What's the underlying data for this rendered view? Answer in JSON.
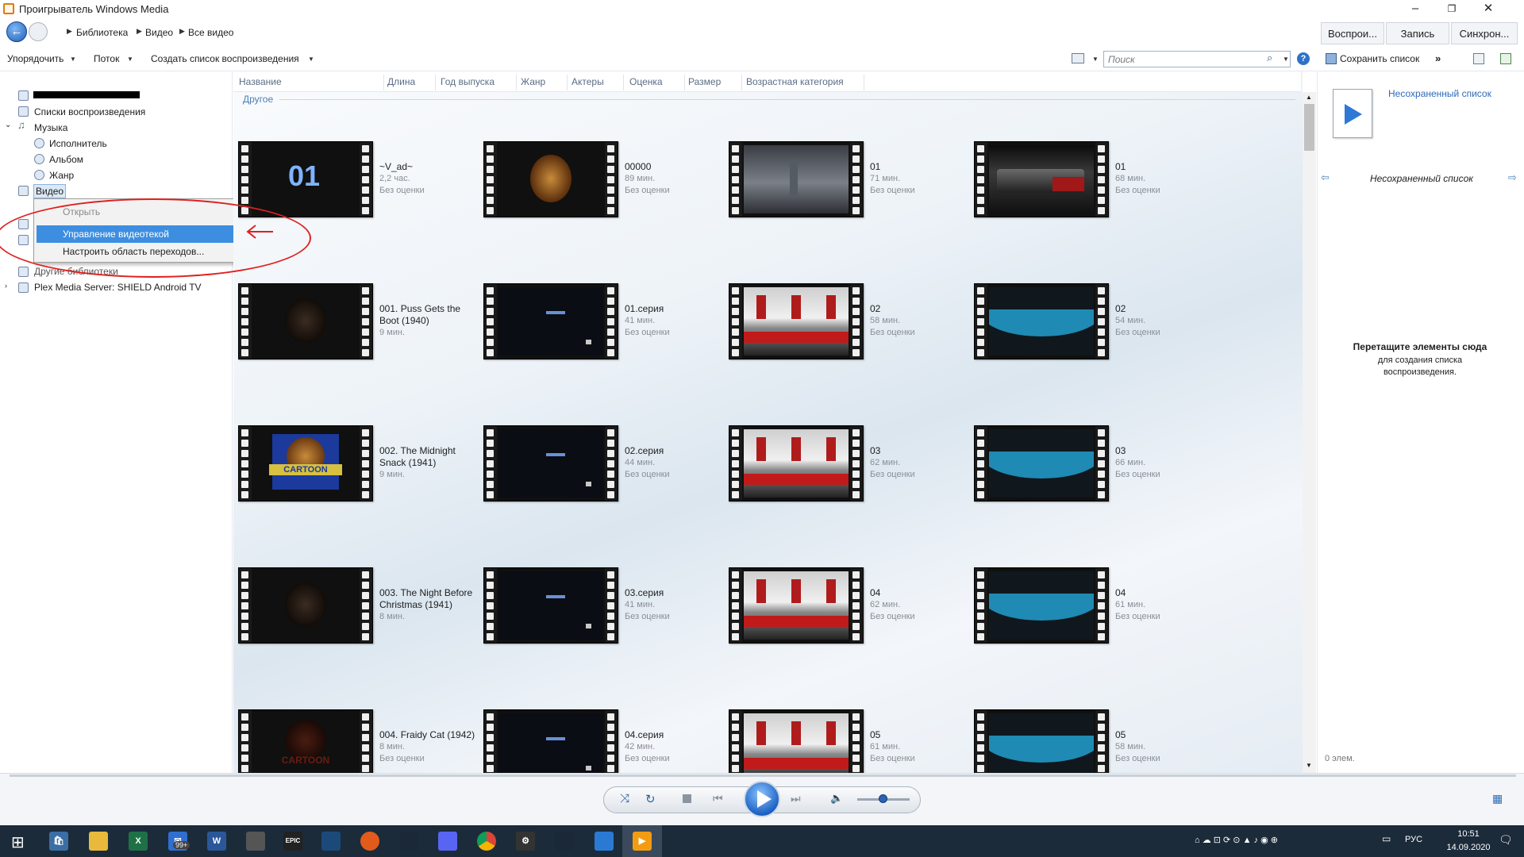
{
  "window": {
    "title": "Проигрыватель Windows Media"
  },
  "breadcrumb": [
    "Библиотека",
    "Видео",
    "Все видео"
  ],
  "tabs": [
    "Воспрои...",
    "Запись",
    "Синхрон..."
  ],
  "toolbar": {
    "organize": "Упорядочить",
    "stream": "Поток",
    "create_playlist": "Создать список воспроизведения",
    "search_placeholder": "Поиск",
    "save_list": "Сохранить список"
  },
  "nav": {
    "playlists": "Списки воспроизведения",
    "music": "Музыка",
    "artist": "Исполнитель",
    "album": "Альбом",
    "genre": "Жанр",
    "video": "Видео",
    "other_libraries": "Другие библиотеки",
    "plex": "Plex Media Server: SHIELD Android TV"
  },
  "context_menu": [
    "Открыть",
    "Управление видеотекой",
    "Настроить область переходов..."
  ],
  "columns": [
    "Название",
    "Длина",
    "Год выпуска",
    "Жанр",
    "Актеры",
    "Оценка",
    "Размер",
    "Возрастная категория"
  ],
  "group_header": "Другое",
  "videos": [
    {
      "title": "~V_ad~",
      "duration": "2,2 час.",
      "rating": "Без оценки",
      "thumb": "title01"
    },
    {
      "title": "00000",
      "duration": "89 мин.",
      "rating": "Без оценки",
      "thumb": "lion"
    },
    {
      "title": "01",
      "duration": "71 мин.",
      "rating": "Без оценки",
      "thumb": "city"
    },
    {
      "title": "01",
      "duration": "68 мин.",
      "rating": "Без оценки",
      "thumb": "train"
    },
    {
      "title": "001. Puss Gets the Boot (1940)",
      "duration": "9 мин.",
      "rating": "",
      "thumb": "darklion"
    },
    {
      "title": "01.серия",
      "duration": "41 мин.",
      "rating": "Без оценки",
      "thumb": "darkscreen"
    },
    {
      "title": "02",
      "duration": "58 мин.",
      "rating": "Без оценки",
      "thumb": "redtrain"
    },
    {
      "title": "02",
      "duration": "54 мин.",
      "rating": "Без оценки",
      "thumb": "prime"
    },
    {
      "title": "002. The Midnight Snack (1941)",
      "duration": "9 мин.",
      "rating": "",
      "thumb": "cartoon"
    },
    {
      "title": "02.серия",
      "duration": "44 мин.",
      "rating": "Без оценки",
      "thumb": "darkscreen"
    },
    {
      "title": "03",
      "duration": "62 мин.",
      "rating": "Без оценки",
      "thumb": "redtrain"
    },
    {
      "title": "03",
      "duration": "66 мин.",
      "rating": "Без оценки",
      "thumb": "prime"
    },
    {
      "title": "003. The Night Before Christmas (1941)",
      "duration": "8 мин.",
      "rating": "",
      "thumb": "darklion"
    },
    {
      "title": "03.серия",
      "duration": "41 мин.",
      "rating": "Без оценки",
      "thumb": "darkscreen"
    },
    {
      "title": "04",
      "duration": "62 мин.",
      "rating": "Без оценки",
      "thumb": "redtrain"
    },
    {
      "title": "04",
      "duration": "61 мин.",
      "rating": "Без оценки",
      "thumb": "prime"
    },
    {
      "title": "004. Fraidy Cat (1942)",
      "duration": "8 мин.",
      "rating": "Без оценки",
      "thumb": "darkcartoon"
    },
    {
      "title": "04.серия",
      "duration": "42 мин.",
      "rating": "Без оценки",
      "thumb": "darkscreen"
    },
    {
      "title": "05",
      "duration": "61 мин.",
      "rating": "Без оценки",
      "thumb": "redtrain"
    },
    {
      "title": "05",
      "duration": "58 мин.",
      "rating": "Без оценки",
      "thumb": "prime"
    }
  ],
  "right_pane": {
    "unsaved_list": "Несохраненный список",
    "nav_label": "Несохраненный список",
    "drag_title": "Перетащите элементы сюда",
    "drag_sub": "для создания списка воспроизведения.",
    "count": "0 элем."
  },
  "taskbar": {
    "language": "РУС",
    "time": "10:51",
    "date": "14.09.2020",
    "mail_badge": "99+"
  },
  "colors": {
    "accent": "#3d8ee0",
    "annotation": "#e02020",
    "taskbar": "#1c2b3a"
  }
}
